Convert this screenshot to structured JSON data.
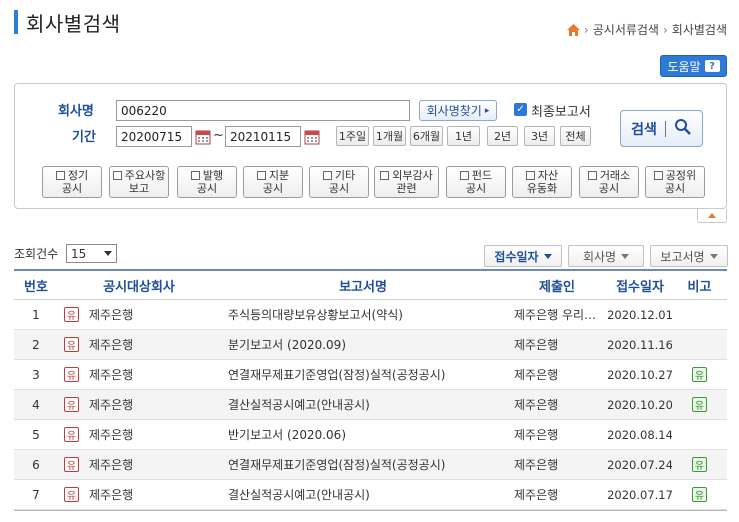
{
  "header": {
    "title": "회사별검색",
    "breadcrumb": [
      "공시서류검색",
      "회사별검색"
    ],
    "help_label": "도움말",
    "help_glyph": "?"
  },
  "search": {
    "company_label": "회사명",
    "company_value": "006220",
    "find_company_label": "회사명찾기",
    "final_report_checked": true,
    "final_report_label": "최종보고서",
    "period_label": "기간",
    "date_start": "20200715",
    "date_end": "20210115",
    "period_buttons": [
      "1주일",
      "1개월",
      "6개월",
      "1년",
      "2년",
      "3년",
      "전체"
    ],
    "search_label": "검색",
    "types": [
      [
        "정기",
        "공시"
      ],
      [
        "주요사항",
        "보고"
      ],
      [
        "발행",
        "공시"
      ],
      [
        "지분",
        "공시"
      ],
      [
        "기타",
        "공시"
      ],
      [
        "외부감사",
        "관련"
      ],
      [
        "펀드",
        "공시"
      ],
      [
        "자산",
        "유동화"
      ],
      [
        "거래소",
        "공시"
      ],
      [
        "공정위",
        "공시"
      ]
    ]
  },
  "list": {
    "count_label": "조회건수",
    "count_value": "15",
    "sort_buttons": [
      "접수일자",
      "회사명",
      "보고서명"
    ],
    "columns": [
      "번호",
      "공시대상회사",
      "보고서명",
      "제출인",
      "접수일자",
      "비고"
    ],
    "market_glyph": "유",
    "rows": [
      {
        "no": "1",
        "company": "제주은행",
        "report": "주식등의대량보유상황보고서(약식)",
        "submitter": "제주은행 우리…",
        "date": "2020.12.01",
        "note": ""
      },
      {
        "no": "2",
        "company": "제주은행",
        "report": "분기보고서 (2020.09)",
        "submitter": "제주은행",
        "date": "2020.11.16",
        "note": ""
      },
      {
        "no": "3",
        "company": "제주은행",
        "report": "연결재무제표기준영업(잠정)실적(공정공시)",
        "submitter": "제주은행",
        "date": "2020.10.27",
        "note": "유"
      },
      {
        "no": "4",
        "company": "제주은행",
        "report": "결산실적공시예고(안내공시)",
        "submitter": "제주은행",
        "date": "2020.10.20",
        "note": "유"
      },
      {
        "no": "5",
        "company": "제주은행",
        "report": "반기보고서 (2020.06)",
        "submitter": "제주은행",
        "date": "2020.08.14",
        "note": ""
      },
      {
        "no": "6",
        "company": "제주은행",
        "report": "연결재무제표기준영업(잠정)실적(공정공시)",
        "submitter": "제주은행",
        "date": "2020.07.24",
        "note": "유"
      },
      {
        "no": "7",
        "company": "제주은행",
        "report": "결산실적공시예고(안내공시)",
        "submitter": "제주은행",
        "date": "2020.07.17",
        "note": "유"
      }
    ]
  },
  "colors": {
    "accent": "#2f7ad6",
    "label_blue": "#1f4f9b",
    "market_red": "#c23a3a",
    "note_green": "#2e8a2e",
    "home_orange": "#e8792b"
  }
}
